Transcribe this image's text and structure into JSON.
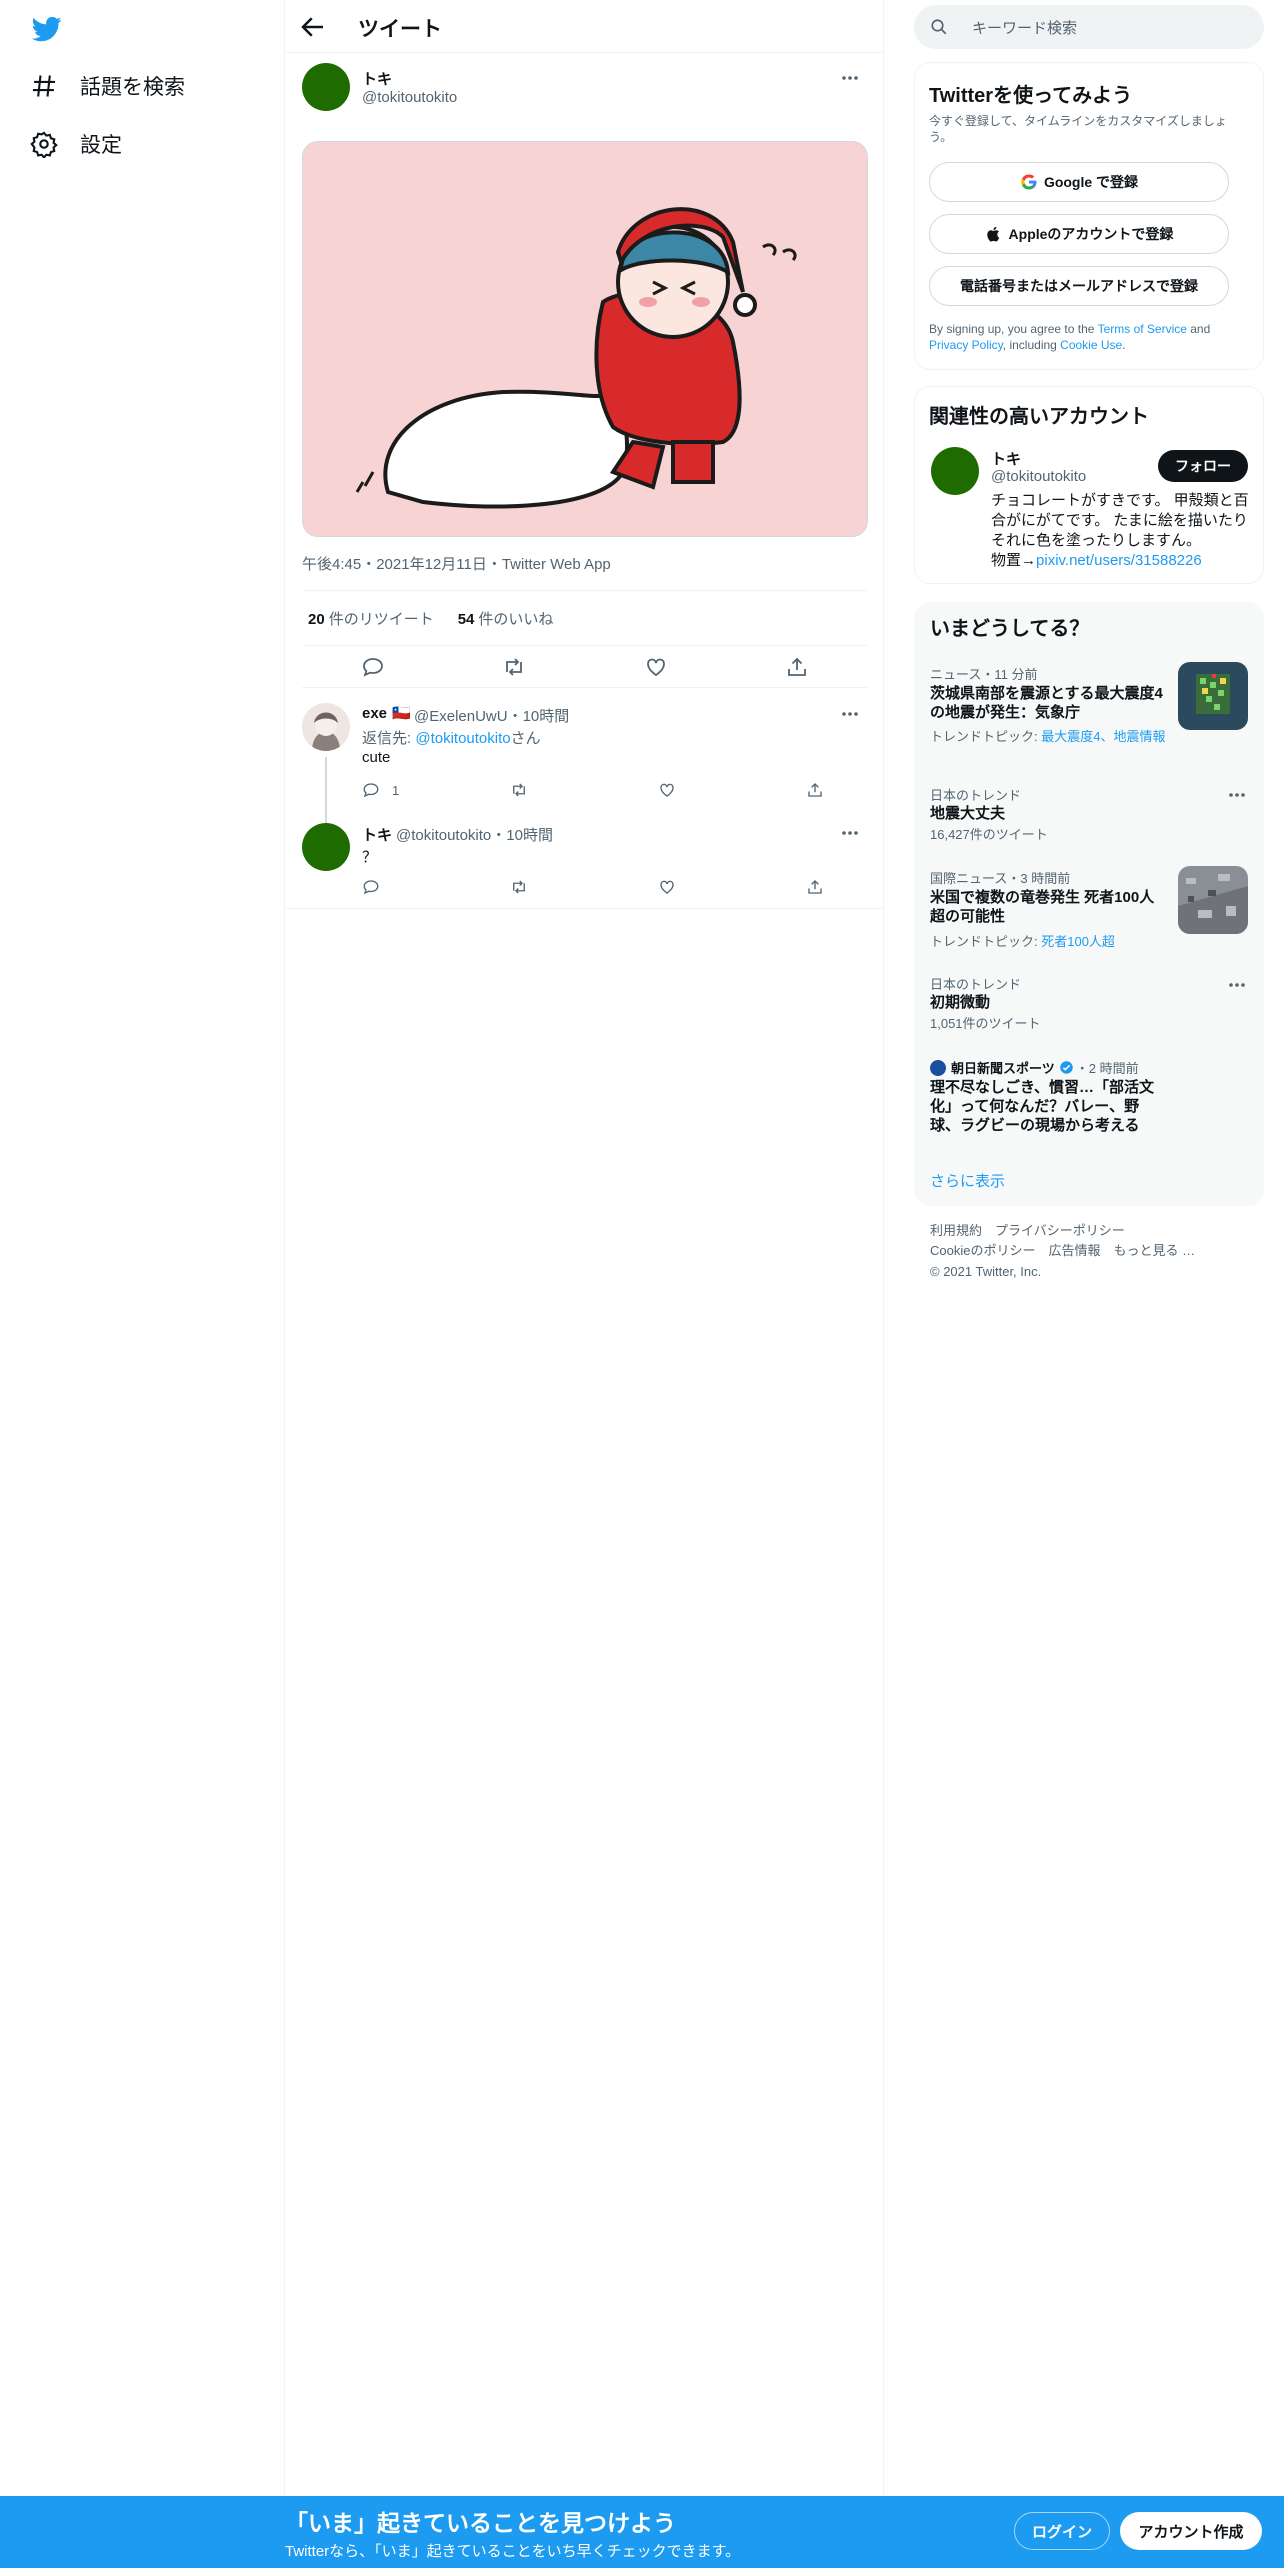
{
  "colors": {
    "accent": "#1d9bf0",
    "text": "#0f1419",
    "secondary": "#536471",
    "avatar": "#1e6b00"
  },
  "nav": {
    "logo_icon": "twitter-bird-icon",
    "items": [
      {
        "icon": "hashtag-icon",
        "label": "話題を検索"
      },
      {
        "icon": "gear-icon",
        "label": "設定"
      }
    ]
  },
  "header": {
    "title": "ツイート",
    "back_icon": "arrow-left-icon"
  },
  "tweet": {
    "author_name": "トキ",
    "author_handle": "@tokitoutokito",
    "timestamp": "午後4:45・2021年12月11日・Twitter Web App",
    "retweets_count": "20",
    "retweets_label": "件のリツイート",
    "likes_count": "54",
    "likes_label": "件のいいね"
  },
  "replies": [
    {
      "name": "exe",
      "flag": "🇨🇱",
      "handle_time": "@ExelenUwU・10時間",
      "reply_to_prefix": "返信先: ",
      "reply_to_handle": "@tokitoutokito",
      "reply_to_suffix": "さん",
      "text": "cute",
      "reply_count": "1"
    },
    {
      "name": "トキ",
      "handle_time": "@tokitoutokito・10時間",
      "text": "？"
    }
  ],
  "sidebar": {
    "search_placeholder": "キーワード検索",
    "signup": {
      "title": "Twitterを使ってみよう",
      "subtitle": "今すぐ登録して、タイムラインをカスタマイズしましょう。",
      "google_button": "Google で登録",
      "apple_button": "Appleのアカウントで登録",
      "phone_button": "電話番号またはメールアドレスで登録",
      "terms_prefix": "By signing up, you agree to the ",
      "terms_link": "Terms of Service",
      "terms_and": " and ",
      "privacy_link": "Privacy Policy",
      "terms_including": ", including ",
      "cookie_link": "Cookie Use",
      "terms_end": "."
    },
    "related": {
      "title": "関連性の高いアカウント",
      "name": "トキ",
      "handle": "@tokitoutokito",
      "follow_button": "フォロー",
      "bio": "チョコレートがすきです。 甲殻類と百合がにがてです。 たまに絵を描いたりそれに色を塗ったりしますん。",
      "bio_prefix": "物置→",
      "bio_link": "pixiv.net/users/31588226"
    },
    "trends": {
      "title": "いまどうしてる？",
      "items": [
        {
          "category": "ニュース・11 分前",
          "title": "茨城県南部を震源とする最大震度4の地震が発生：気象庁",
          "topics_prefix": "トレンドトピック: ",
          "topics": "最大震度4、地震情報"
        },
        {
          "category": "日本のトレンド",
          "title": "地震大丈夫",
          "tweets": "16,427件のツイート"
        },
        {
          "category": "国際ニュース・3 時間前",
          "title": "米国で複数の竜巻発生 死者100人超の可能性",
          "topics_prefix": "トレンドトピック: ",
          "topics": "死者100人超"
        },
        {
          "category": "日本のトレンド",
          "title": "初期微動",
          "tweets": "1,051件のツイート"
        },
        {
          "source": "朝日新聞スポーツ",
          "time": "・2 時間前",
          "title": "理不尽なしごき、慣習…「部活文化」って何なんだ？バレー、野球、ラグビーの現場から考える"
        }
      ],
      "show_more": "さらに表示"
    },
    "footer": {
      "links_row1": "利用規約　プライバシーポリシー",
      "links_row2": "Cookieのポリシー　広告情報　もっと見る …",
      "copyright": "© 2021 Twitter, Inc."
    }
  },
  "banner": {
    "title": "「いま」起きていることを見つけよう",
    "subtitle": "Twitterなら、「いま」起きていることをいち早くチェックできます。",
    "login": "ログイン",
    "signup": "アカウント作成"
  }
}
